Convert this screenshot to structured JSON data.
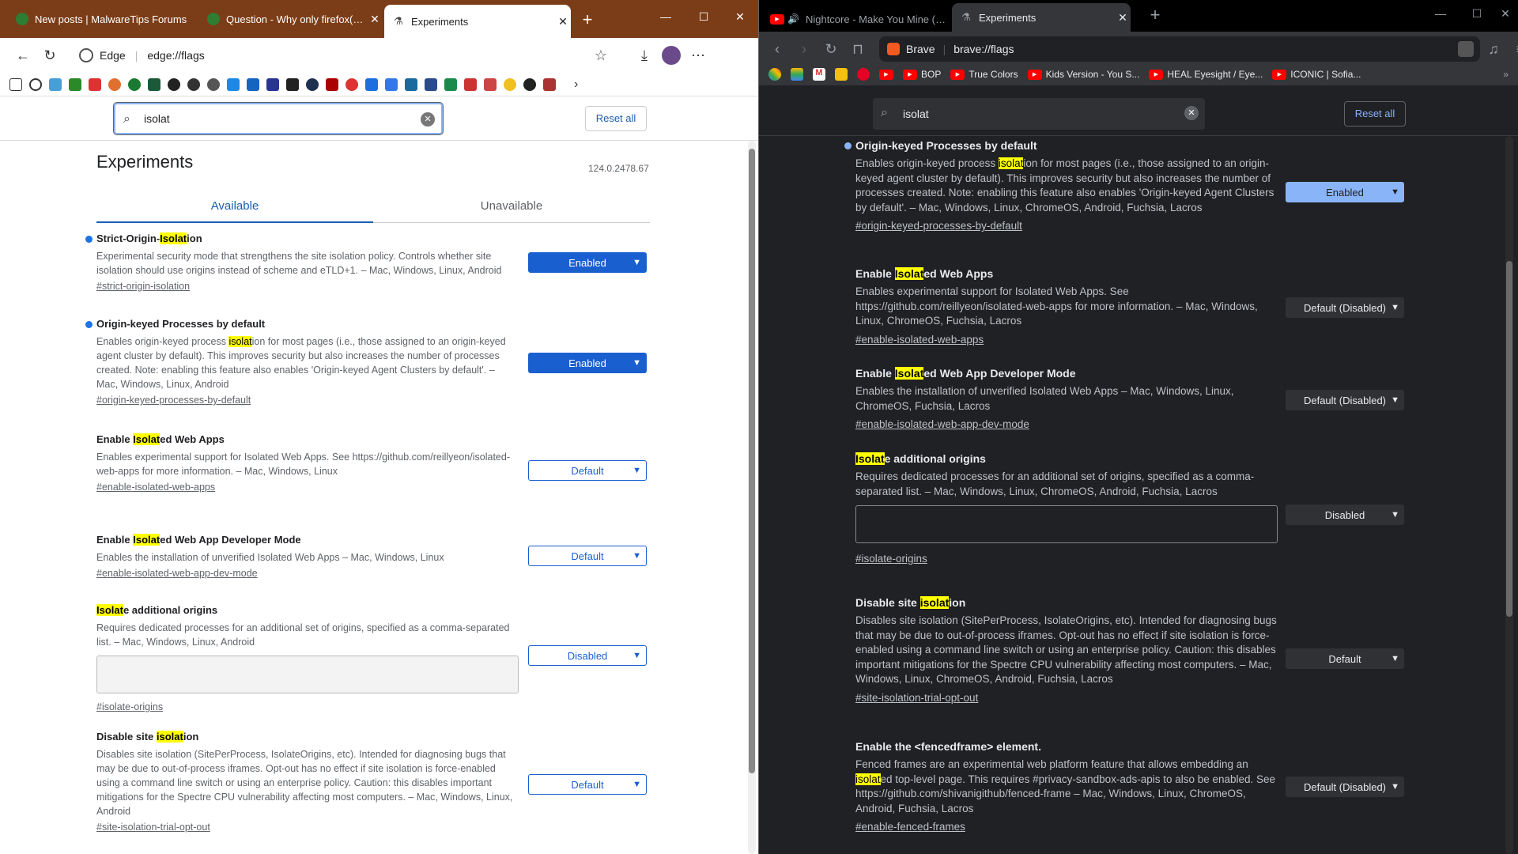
{
  "edge": {
    "tabs": [
      {
        "label": "New posts | MalwareTips Forums"
      },
      {
        "label": "Question - Why only firefox(and"
      },
      {
        "label": "Experiments"
      }
    ],
    "browser_name": "Edge",
    "url": "edge://flags",
    "search": {
      "value": "isolat"
    },
    "reset_label": "Reset all",
    "title": "Experiments",
    "version": "124.0.2478.67",
    "tab_available": "Available",
    "tab_unavailable": "Unavailable",
    "flags": [
      {
        "pre": "Strict-Origin-",
        "hl": "Isolat",
        "post": "ion",
        "desc": "Experimental security mode that strengthens the site isolation policy. Controls whether site isolation should use origins instead of scheme and eTLD+1. – Mac, Windows, Linux, Android",
        "link": "#strict-origin-isolation",
        "value": "Enabled"
      },
      {
        "pre": "Origin-keyed Processes by default",
        "hl": "",
        "post": "",
        "desc_pre": "Enables origin-keyed process ",
        "desc_hl": "isolat",
        "desc_post": "ion for most pages (i.e., those assigned to an origin-keyed agent cluster by default). This improves security but also increases the number of processes created. Note: enabling this feature also enables 'Origin-keyed Agent Clusters by default'. – Mac, Windows, Linux, Android",
        "link": "#origin-keyed-processes-by-default",
        "value": "Enabled"
      },
      {
        "pre": "Enable ",
        "hl": "Isolat",
        "post": "ed Web Apps",
        "desc": "Enables experimental support for Isolated Web Apps. See https://github.com/reillyeon/isolated-web-apps for more information. – Mac, Windows, Linux",
        "link": "#enable-isolated-web-apps",
        "value": "Default"
      },
      {
        "pre": "Enable ",
        "hl": "Isolat",
        "post": "ed Web App Developer Mode",
        "desc": "Enables the installation of unverified Isolated Web Apps – Mac, Windows, Linux",
        "link": "#enable-isolated-web-app-dev-mode",
        "value": "Default"
      },
      {
        "pre": "",
        "hl": "Isolat",
        "post": "e additional origins",
        "desc": "Requires dedicated processes for an additional set of origins, specified as a comma-separated list. – Mac, Windows, Linux, Android",
        "link": "#isolate-origins",
        "value": "Disabled"
      },
      {
        "pre": "Disable site ",
        "hl": "isolat",
        "post": "ion",
        "desc": "Disables site isolation (SitePerProcess, IsolateOrigins, etc). Intended for diagnosing bugs that may be due to out-of-process iframes. Opt-out has no effect if site isolation is force-enabled using a command line switch or using an enterprise policy. Caution: this disables important mitigations for the Spectre CPU vulnerability affecting most computers. – Mac, Windows, Linux, Android",
        "link": "#site-isolation-trial-opt-out",
        "value": "Default"
      }
    ]
  },
  "brave": {
    "tabs": [
      {
        "label": "Nightcore - Make You Mine (Kille"
      },
      {
        "label": "Experiments"
      }
    ],
    "browser_name": "Brave",
    "url": "brave://flags",
    "bookmarks": [
      "BOP",
      "True Colors",
      "Kids Version - You S...",
      "HEAL Eyesight / Eye...",
      "ICONIC | Sofia..."
    ],
    "search": {
      "value": "isolat"
    },
    "reset_label": "Reset all",
    "flags": [
      {
        "pre": "Origin-keyed Processes by default",
        "hl": "",
        "post": "",
        "desc_pre": "Enables origin-keyed process ",
        "desc_hl": "isolat",
        "desc_post": "ion for most pages (i.e., those assigned to an origin-keyed agent cluster by default). This improves security but also increases the number of processes created. Note: enabling this feature also enables 'Origin-keyed Agent Clusters by default'. – Mac, Windows, Linux, ChromeOS, Android, Fuchsia, Lacros",
        "link": "#origin-keyed-processes-by-default",
        "value": "Enabled"
      },
      {
        "pre": "Enable ",
        "hl": "Isolat",
        "post": "ed Web Apps",
        "desc": "Enables experimental support for Isolated Web Apps. See https://github.com/reillyeon/isolated-web-apps for more information. – Mac, Windows, Linux, ChromeOS, Fuchsia, Lacros",
        "link": "#enable-isolated-web-apps",
        "value": "Default (Disabled)"
      },
      {
        "pre": "Enable ",
        "hl": "Isolat",
        "post": "ed Web App Developer Mode",
        "desc": "Enables the installation of unverified Isolated Web Apps – Mac, Windows, Linux, ChromeOS, Fuchsia, Lacros",
        "link": "#enable-isolated-web-app-dev-mode",
        "value": "Default (Disabled)"
      },
      {
        "pre": "",
        "hl": "Isolat",
        "post": "e additional origins",
        "desc": "Requires dedicated processes for an additional set of origins, specified as a comma-separated list. – Mac, Windows, Linux, ChromeOS, Android, Fuchsia, Lacros",
        "link": "#isolate-origins",
        "value": "Disabled"
      },
      {
        "pre": "Disable site ",
        "hl": "isolat",
        "post": "ion",
        "desc": "Disables site isolation (SitePerProcess, IsolateOrigins, etc). Intended for diagnosing bugs that may be due to out-of-process iframes. Opt-out has no effect if site isolation is force-enabled using a command line switch or using an enterprise policy. Caution: this disables important mitigations for the Spectre CPU vulnerability affecting most computers. – Mac, Windows, Linux, ChromeOS, Android, Fuchsia, Lacros",
        "link": "#site-isolation-trial-opt-out",
        "value": "Default"
      },
      {
        "pre": "Enable the <fencedframe> element.",
        "hl": "",
        "post": "",
        "desc_pre": "Fenced frames are an experimental web platform feature that allows embedding an ",
        "desc_hl": "isolat",
        "desc_post": "ed top-level page. This requires #privacy-sandbox-ads-apis to also be enabled. See https://github.com/shivanigithub/fenced-frame – Mac, Windows, Linux, ChromeOS, Android, Fuchsia, Lacros",
        "link": "#enable-fenced-frames",
        "value": "Default (Disabled)"
      }
    ]
  }
}
